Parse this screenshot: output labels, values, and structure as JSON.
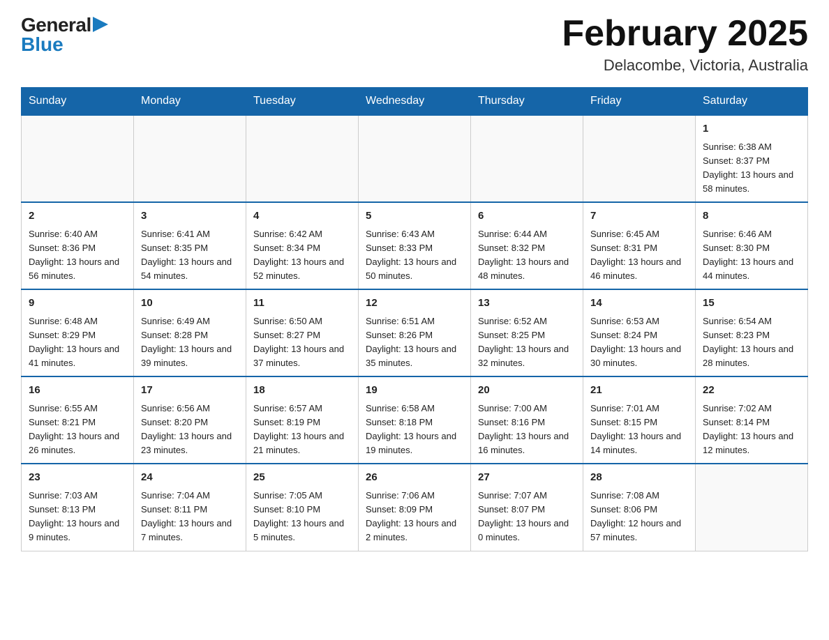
{
  "logo": {
    "general": "General",
    "blue": "Blue",
    "arrow": "▶"
  },
  "title": "February 2025",
  "subtitle": "Delacombe, Victoria, Australia",
  "days_of_week": [
    "Sunday",
    "Monday",
    "Tuesday",
    "Wednesday",
    "Thursday",
    "Friday",
    "Saturday"
  ],
  "weeks": [
    [
      {
        "day": "",
        "info": ""
      },
      {
        "day": "",
        "info": ""
      },
      {
        "day": "",
        "info": ""
      },
      {
        "day": "",
        "info": ""
      },
      {
        "day": "",
        "info": ""
      },
      {
        "day": "",
        "info": ""
      },
      {
        "day": "1",
        "info": "Sunrise: 6:38 AM\nSunset: 8:37 PM\nDaylight: 13 hours and 58 minutes."
      }
    ],
    [
      {
        "day": "2",
        "info": "Sunrise: 6:40 AM\nSunset: 8:36 PM\nDaylight: 13 hours and 56 minutes."
      },
      {
        "day": "3",
        "info": "Sunrise: 6:41 AM\nSunset: 8:35 PM\nDaylight: 13 hours and 54 minutes."
      },
      {
        "day": "4",
        "info": "Sunrise: 6:42 AM\nSunset: 8:34 PM\nDaylight: 13 hours and 52 minutes."
      },
      {
        "day": "5",
        "info": "Sunrise: 6:43 AM\nSunset: 8:33 PM\nDaylight: 13 hours and 50 minutes."
      },
      {
        "day": "6",
        "info": "Sunrise: 6:44 AM\nSunset: 8:32 PM\nDaylight: 13 hours and 48 minutes."
      },
      {
        "day": "7",
        "info": "Sunrise: 6:45 AM\nSunset: 8:31 PM\nDaylight: 13 hours and 46 minutes."
      },
      {
        "day": "8",
        "info": "Sunrise: 6:46 AM\nSunset: 8:30 PM\nDaylight: 13 hours and 44 minutes."
      }
    ],
    [
      {
        "day": "9",
        "info": "Sunrise: 6:48 AM\nSunset: 8:29 PM\nDaylight: 13 hours and 41 minutes."
      },
      {
        "day": "10",
        "info": "Sunrise: 6:49 AM\nSunset: 8:28 PM\nDaylight: 13 hours and 39 minutes."
      },
      {
        "day": "11",
        "info": "Sunrise: 6:50 AM\nSunset: 8:27 PM\nDaylight: 13 hours and 37 minutes."
      },
      {
        "day": "12",
        "info": "Sunrise: 6:51 AM\nSunset: 8:26 PM\nDaylight: 13 hours and 35 minutes."
      },
      {
        "day": "13",
        "info": "Sunrise: 6:52 AM\nSunset: 8:25 PM\nDaylight: 13 hours and 32 minutes."
      },
      {
        "day": "14",
        "info": "Sunrise: 6:53 AM\nSunset: 8:24 PM\nDaylight: 13 hours and 30 minutes."
      },
      {
        "day": "15",
        "info": "Sunrise: 6:54 AM\nSunset: 8:23 PM\nDaylight: 13 hours and 28 minutes."
      }
    ],
    [
      {
        "day": "16",
        "info": "Sunrise: 6:55 AM\nSunset: 8:21 PM\nDaylight: 13 hours and 26 minutes."
      },
      {
        "day": "17",
        "info": "Sunrise: 6:56 AM\nSunset: 8:20 PM\nDaylight: 13 hours and 23 minutes."
      },
      {
        "day": "18",
        "info": "Sunrise: 6:57 AM\nSunset: 8:19 PM\nDaylight: 13 hours and 21 minutes."
      },
      {
        "day": "19",
        "info": "Sunrise: 6:58 AM\nSunset: 8:18 PM\nDaylight: 13 hours and 19 minutes."
      },
      {
        "day": "20",
        "info": "Sunrise: 7:00 AM\nSunset: 8:16 PM\nDaylight: 13 hours and 16 minutes."
      },
      {
        "day": "21",
        "info": "Sunrise: 7:01 AM\nSunset: 8:15 PM\nDaylight: 13 hours and 14 minutes."
      },
      {
        "day": "22",
        "info": "Sunrise: 7:02 AM\nSunset: 8:14 PM\nDaylight: 13 hours and 12 minutes."
      }
    ],
    [
      {
        "day": "23",
        "info": "Sunrise: 7:03 AM\nSunset: 8:13 PM\nDaylight: 13 hours and 9 minutes."
      },
      {
        "day": "24",
        "info": "Sunrise: 7:04 AM\nSunset: 8:11 PM\nDaylight: 13 hours and 7 minutes."
      },
      {
        "day": "25",
        "info": "Sunrise: 7:05 AM\nSunset: 8:10 PM\nDaylight: 13 hours and 5 minutes."
      },
      {
        "day": "26",
        "info": "Sunrise: 7:06 AM\nSunset: 8:09 PM\nDaylight: 13 hours and 2 minutes."
      },
      {
        "day": "27",
        "info": "Sunrise: 7:07 AM\nSunset: 8:07 PM\nDaylight: 13 hours and 0 minutes."
      },
      {
        "day": "28",
        "info": "Sunrise: 7:08 AM\nSunset: 8:06 PM\nDaylight: 12 hours and 57 minutes."
      },
      {
        "day": "",
        "info": ""
      }
    ]
  ]
}
